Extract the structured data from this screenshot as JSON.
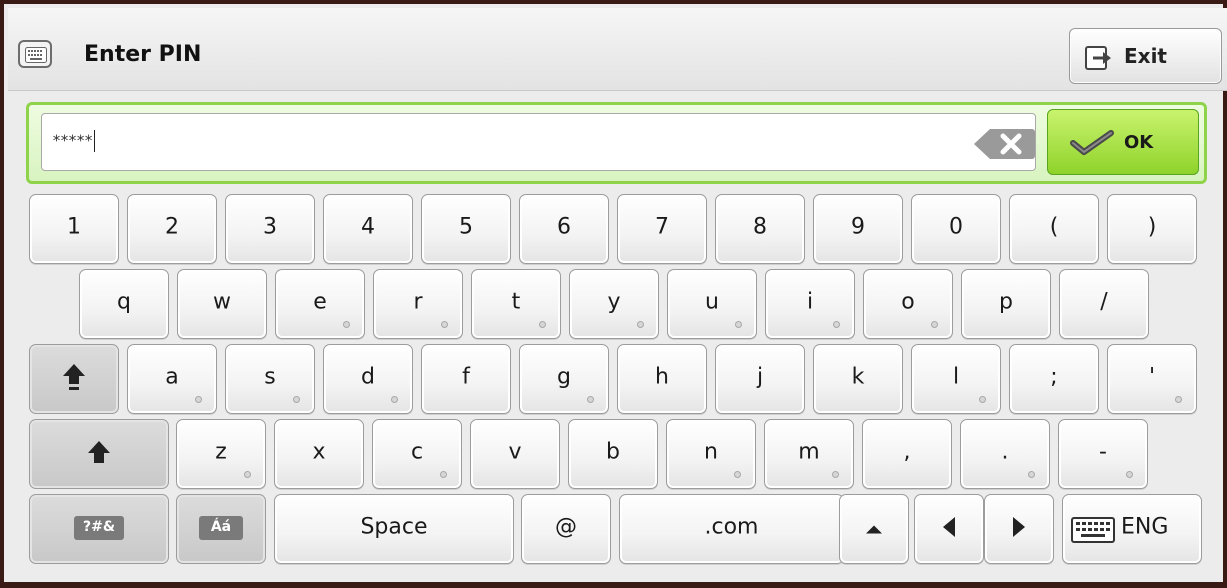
{
  "header": {
    "title": "Enter PIN",
    "exit_label": "Exit"
  },
  "input": {
    "value": "*****",
    "ok_label": "OK"
  },
  "keyboard": {
    "row1": [
      {
        "label": "1"
      },
      {
        "label": "2"
      },
      {
        "label": "3"
      },
      {
        "label": "4"
      },
      {
        "label": "5"
      },
      {
        "label": "6"
      },
      {
        "label": "7"
      },
      {
        "label": "8"
      },
      {
        "label": "9"
      },
      {
        "label": "0"
      },
      {
        "label": "("
      },
      {
        "label": ")"
      }
    ],
    "row2": [
      {
        "label": "q"
      },
      {
        "label": "w"
      },
      {
        "label": "e",
        "accent": true
      },
      {
        "label": "r",
        "accent": true
      },
      {
        "label": "t",
        "accent": true
      },
      {
        "label": "y",
        "accent": true
      },
      {
        "label": "u",
        "accent": true
      },
      {
        "label": "i",
        "accent": true
      },
      {
        "label": "o",
        "accent": true
      },
      {
        "label": "p"
      },
      {
        "label": "/"
      }
    ],
    "row3": [
      {
        "label": "a",
        "accent": true
      },
      {
        "label": "s",
        "accent": true
      },
      {
        "label": "d",
        "accent": true
      },
      {
        "label": "f"
      },
      {
        "label": "g",
        "accent": true
      },
      {
        "label": "h"
      },
      {
        "label": "j"
      },
      {
        "label": "k"
      },
      {
        "label": "l",
        "accent": true
      },
      {
        "label": ";"
      },
      {
        "label": "'",
        "accent": true
      }
    ],
    "row4": [
      {
        "label": "z",
        "accent": true
      },
      {
        "label": "x"
      },
      {
        "label": "c",
        "accent": true
      },
      {
        "label": "v"
      },
      {
        "label": "b"
      },
      {
        "label": "n",
        "accent": true
      },
      {
        "label": "m",
        "accent": true
      },
      {
        "label": ",",
        "accent": false
      },
      {
        "label": ".",
        "accent": true
      },
      {
        "label": "-",
        "accent": true
      }
    ],
    "bottom": {
      "symbols_label": "?#&",
      "accents_label": "Áá",
      "space_label": "Space",
      "at_label": "@",
      "dotcom_label": ".com",
      "language_label": "ENG"
    },
    "icons": {
      "header": "keyboard-icon",
      "exit": "exit-icon",
      "backspace": "backspace-icon",
      "ok": "checkmark-icon",
      "caps_lock": "caps-lock-icon",
      "shift": "shift-icon",
      "dotcom_menu": "caret-up-icon",
      "cursor_left": "arrow-left-icon",
      "cursor_right": "arrow-right-icon",
      "language": "keyboard-icon"
    }
  }
}
